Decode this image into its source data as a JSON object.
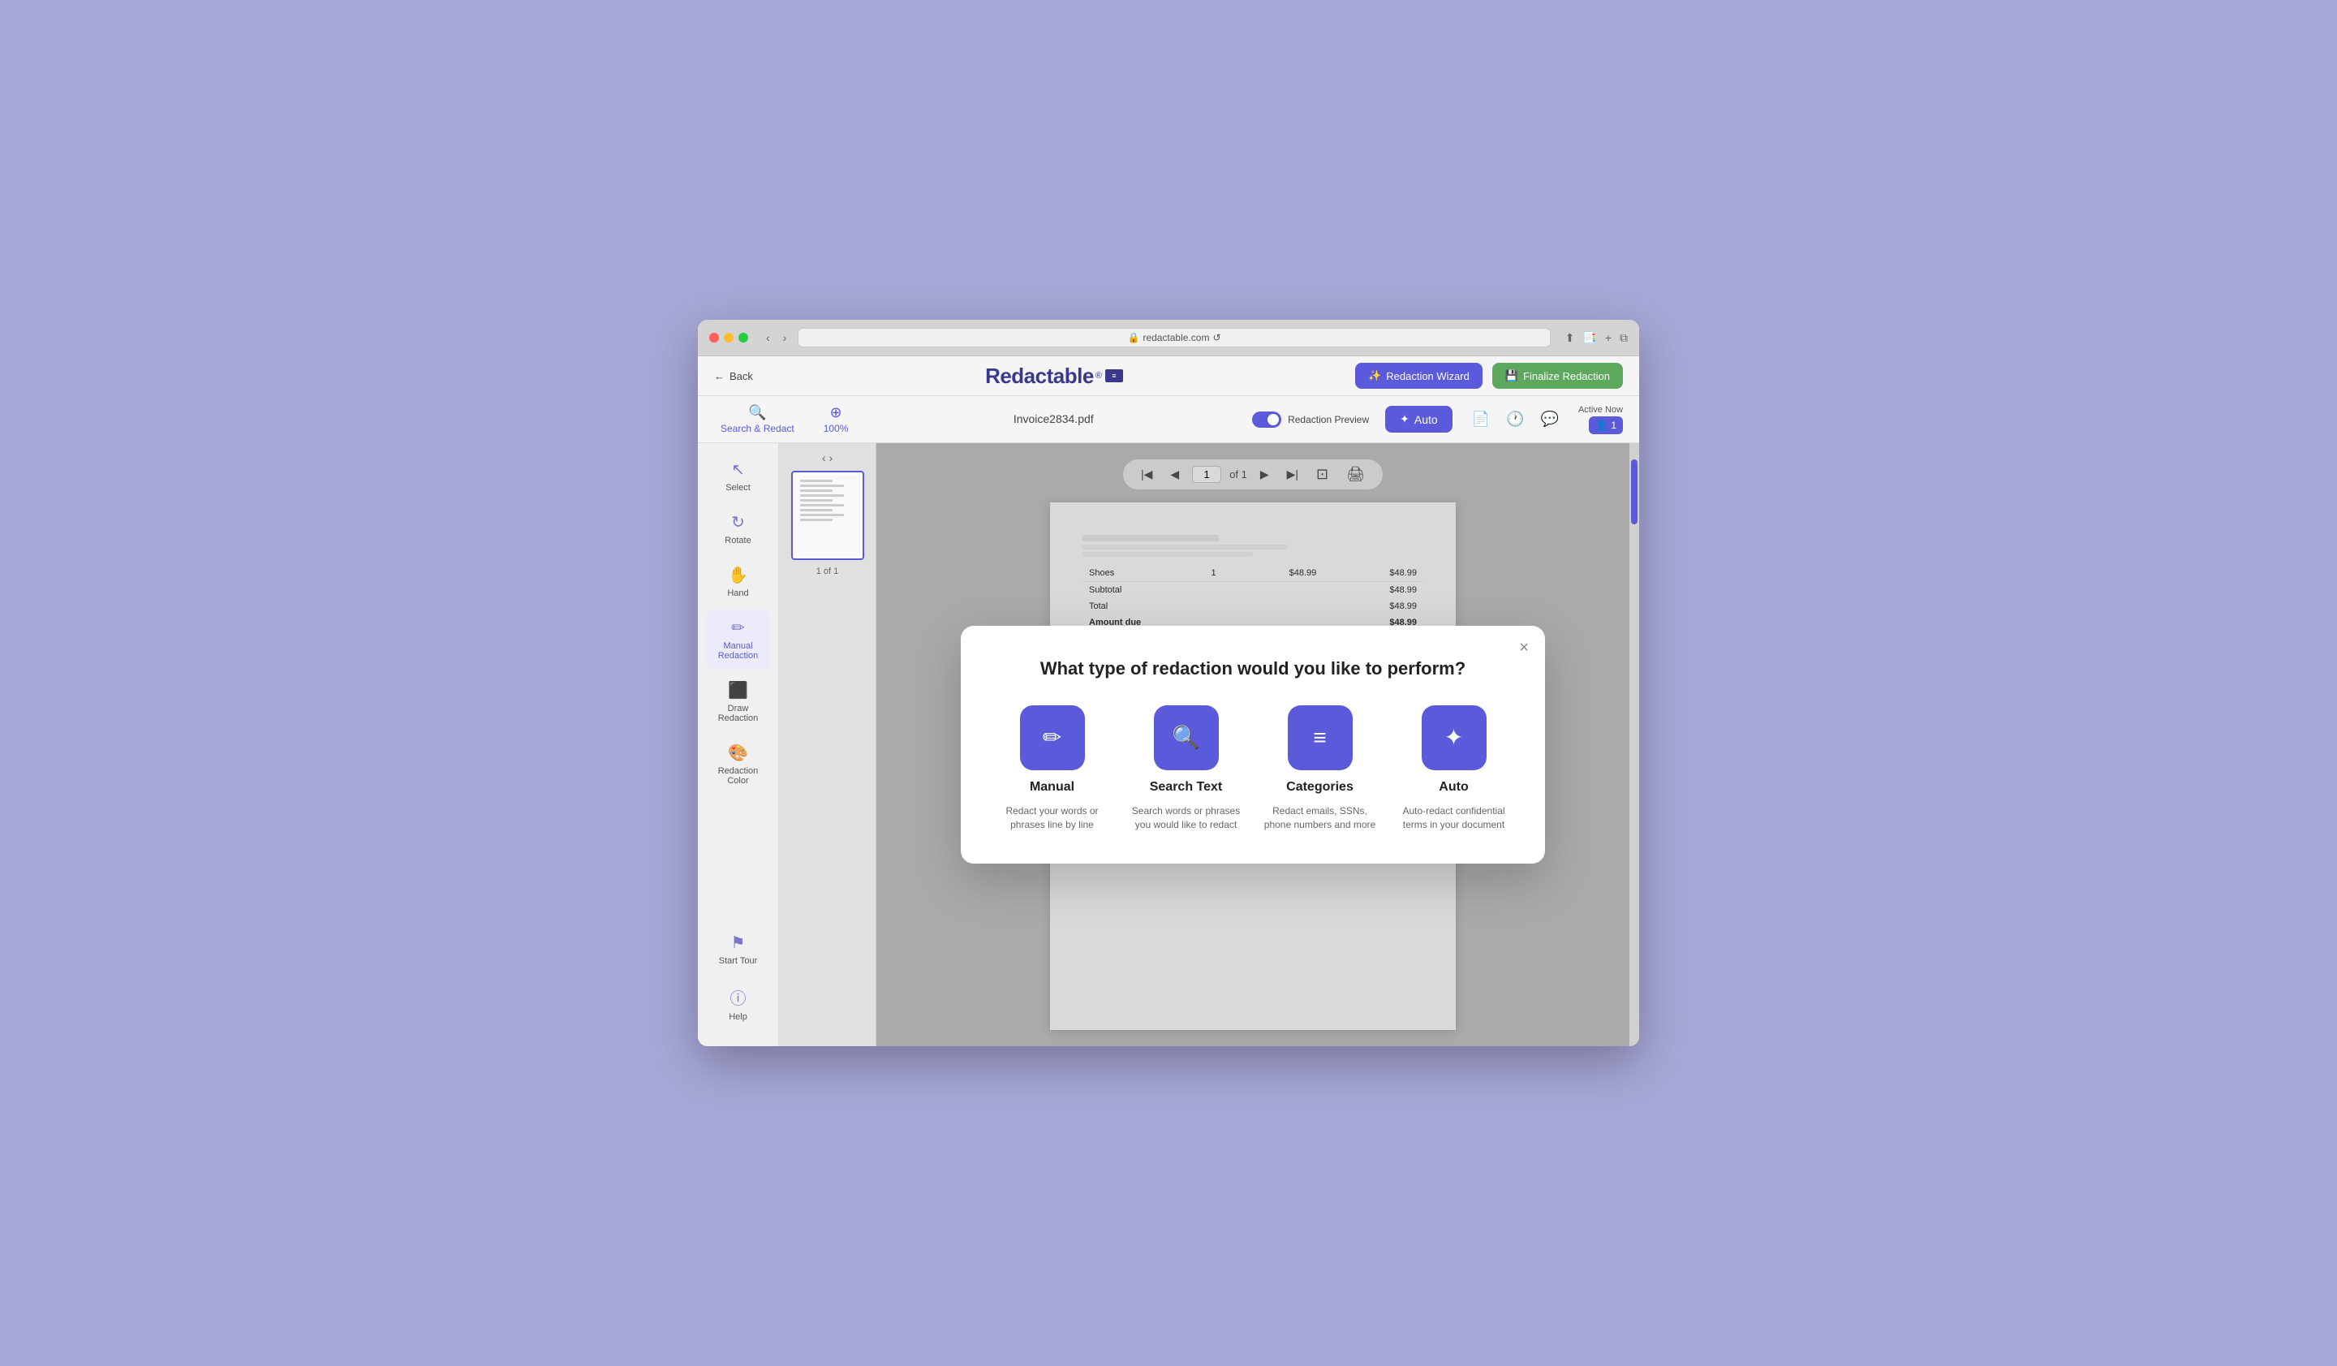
{
  "browser": {
    "url": "redactable.com",
    "reload_label": "↺"
  },
  "app": {
    "logo_text": "Redactable",
    "logo_superscript": "®",
    "back_label": "Back"
  },
  "header": {
    "wizard_button": "Redaction Wizard",
    "finalize_button": "Finalize Redaction",
    "filename": "Invoice2834.pdf",
    "redaction_preview_label": "Redaction Preview",
    "auto_button": "Auto",
    "zoom_level": "100%",
    "search_redact_label": "Search & Redact",
    "active_now_label": "Active Now",
    "active_count": "1"
  },
  "sidebar": {
    "items": [
      {
        "id": "select",
        "label": "Select",
        "icon": "⬚"
      },
      {
        "id": "rotate",
        "label": "Rotate",
        "icon": "↻"
      },
      {
        "id": "hand",
        "label": "Hand",
        "icon": "✋"
      },
      {
        "id": "manual-redaction",
        "label": "Manual Redaction",
        "icon": "✏️"
      },
      {
        "id": "draw-redaction",
        "label": "Draw Redaction",
        "icon": "⬛"
      },
      {
        "id": "redaction-color",
        "label": "Redaction Color",
        "icon": "🎨"
      }
    ],
    "start_tour_label": "Start Tour",
    "help_label": "Help"
  },
  "pagination": {
    "current_page": "1",
    "of_label": "of 1",
    "page_label": "1 of 1"
  },
  "modal": {
    "title": "What type of redaction would you like to perform?",
    "close_label": "×",
    "options": [
      {
        "id": "manual",
        "title": "Manual",
        "description": "Redact your words or phrases line by line",
        "icon": "✏"
      },
      {
        "id": "search-text",
        "title": "Search Text",
        "description": "Search words or phrases you would like to redact",
        "icon": "🔍"
      },
      {
        "id": "categories",
        "title": "Categories",
        "description": "Redact emails, SSNs, phone numbers and more",
        "icon": "≡"
      },
      {
        "id": "auto",
        "title": "Auto",
        "description": "Auto-redact confidential terms in your document",
        "icon": "✦"
      }
    ]
  },
  "invoice": {
    "item_label": "Shoes",
    "qty": "1",
    "price": "$48.99",
    "total": "$48.99",
    "subtotal_label": "Subtotal",
    "subtotal_value": "$48.99",
    "total_label": "Total",
    "total_value": "$48.99",
    "amount_due_label": "Amount due",
    "amount_due_value": "$48.99"
  }
}
